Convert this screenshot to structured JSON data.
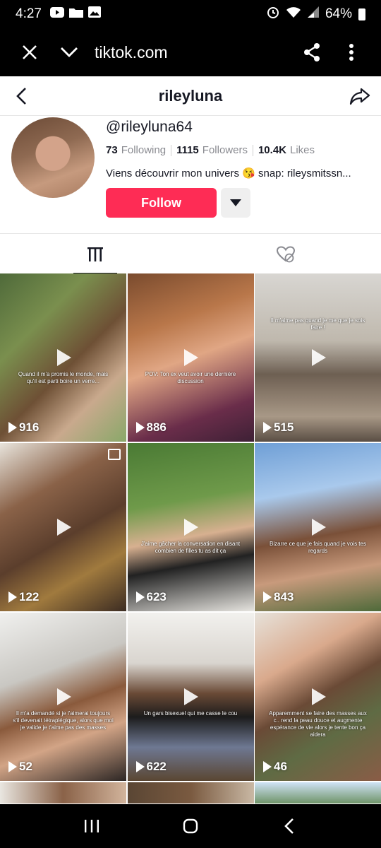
{
  "status_bar": {
    "time": "4:27",
    "battery": "64%",
    "left_icons": [
      "youtube-icon",
      "folder-icon",
      "image-icon"
    ],
    "right_icons": [
      "alarm-icon",
      "wifi-icon",
      "signal-icon",
      "battery-icon"
    ]
  },
  "browser": {
    "url": "tiktok.com",
    "close_icon": "close-icon",
    "menu_icon": "chevron-down-icon",
    "share_icon": "share-icon",
    "more_icon": "more-vertical-icon"
  },
  "profile": {
    "title": "rileyluna",
    "handle": "@rileyluna64",
    "following_count": "73",
    "following_label": "Following",
    "followers_count": "1115",
    "followers_label": "Followers",
    "likes_count": "10.4K",
    "likes_label": "Likes",
    "bio": "Viens découvrir mon univers 😘 snap: rileysmitssn...",
    "follow_label": "Follow"
  },
  "tabs": [
    {
      "icon": "videos-grid-icon",
      "active": true
    },
    {
      "icon": "liked-hidden-icon",
      "active": false
    }
  ],
  "videos": [
    {
      "views": "916",
      "caption": "Quand il m'a promis le monde, mais qu'il est parti boire un verre...",
      "caption_pos": "bottom"
    },
    {
      "views": "886",
      "caption": "POV: Ton ex veut avoir une dernière discussion",
      "caption_pos": "bottom"
    },
    {
      "views": "515",
      "caption": "Il m'aime pas quand je me que je sois faire !",
      "caption_pos": "top"
    },
    {
      "views": "122",
      "caption": "",
      "caption_pos": "bottom",
      "multi": true
    },
    {
      "views": "623",
      "caption": "J'aime gâcher la conversation en disant combien de filles tu as dit ça",
      "caption_pos": "bottom"
    },
    {
      "views": "843",
      "caption": "Bizarre ce que je fais quand je vois tes regards",
      "caption_pos": "bottom"
    },
    {
      "views": "52",
      "caption": "Il m'a demandé si je l'aimerai toujours s'il devenait tétraplégique, alors que moi je valide je t'aime pas des masses",
      "caption_pos": "bottom"
    },
    {
      "views": "622",
      "caption": "Un gars bisexuel qui me casse le cou",
      "caption_pos": "bottom"
    },
    {
      "views": "46",
      "caption": "Apparemment se faire des masses aux c.. rend la peau douce et augmente espérance de vie alors je tente bon ça aidera",
      "caption_pos": "bottom"
    }
  ],
  "nav_bar": {
    "recents_icon": "recents-icon",
    "home_icon": "home-icon",
    "back_icon": "back-icon"
  }
}
